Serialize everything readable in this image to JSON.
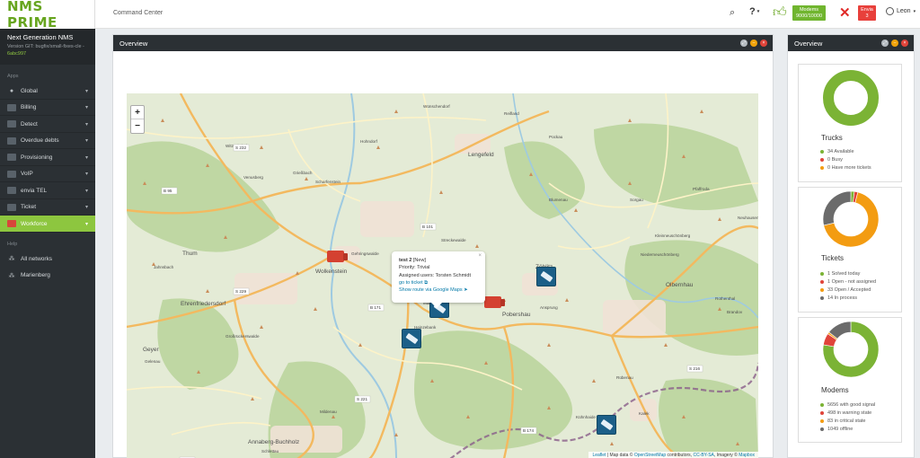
{
  "app": {
    "logo": "NMS PRIME",
    "version_title": "Next Generation NMS",
    "version_text": "Version GIT: bugfix/small-fixes-cle -",
    "version_hash": "6abc997"
  },
  "sidebar": {
    "apps_label": "Apps",
    "help_label": "Help",
    "items": [
      {
        "label": "Global",
        "icon": "globe-icon",
        "active": false
      },
      {
        "label": "Billing",
        "icon": "billing-icon",
        "active": false
      },
      {
        "label": "Detect",
        "icon": "detect-icon",
        "active": false
      },
      {
        "label": "Overdue debts",
        "icon": "overdue-icon",
        "active": false
      },
      {
        "label": "Provisioning",
        "icon": "provisioning-icon",
        "active": false
      },
      {
        "label": "VoIP",
        "icon": "voip-icon",
        "active": false
      },
      {
        "label": "envia TEL",
        "icon": "envia-icon",
        "active": false
      },
      {
        "label": "Ticket",
        "icon": "ticket-icon",
        "active": false
      },
      {
        "label": "Workforce",
        "icon": "workforce-icon",
        "active": true
      }
    ],
    "help_items": [
      {
        "label": "All networks",
        "icon": "network-icon"
      },
      {
        "label": "Marienberg",
        "icon": "network-icon"
      }
    ]
  },
  "header": {
    "title": "Command Center",
    "modems_badge_label": "Modems",
    "modems_badge_value": "9000/10000",
    "envia_badge_label": "Envia",
    "envia_badge_value": "3",
    "user": "Leon",
    "help": "?"
  },
  "map_panel": {
    "title": "Overview",
    "zoom_in": "+",
    "zoom_out": "−",
    "popup": {
      "title": "test 2",
      "state": "[New]",
      "priority": "Priority: Trivial",
      "assigned": "Assigned users: Torsten Schmidt",
      "link_ticket": "go to ticket",
      "link_route": "Show route via Google Maps"
    },
    "attribution": {
      "leaflet": "Leaflet",
      "text1": " | Map data © ",
      "osm": "OpenStreetMap",
      "text2": " contributors, ",
      "ccbysa": "CC-BY-SA",
      "text3": ", Imagery © ",
      "mapbox": "Mapbox"
    },
    "places": [
      {
        "name": "Lengefeld"
      },
      {
        "name": "Wolkenstein"
      },
      {
        "name": "Ehrenfriedersdorf"
      },
      {
        "name": "Thum"
      },
      {
        "name": "Geyer"
      },
      {
        "name": "Annaberg-Buchholz"
      },
      {
        "name": "Olbernhau"
      },
      {
        "name": "Zöblitz"
      },
      {
        "name": "Pobershau"
      },
      {
        "name": "Marienberg"
      },
      {
        "name": "Großrückerswalde"
      },
      {
        "name": "Wünschendorf"
      },
      {
        "name": "Reifland"
      },
      {
        "name": "Pockau"
      },
      {
        "name": "Heinzebank"
      },
      {
        "name": "Rübenau"
      },
      {
        "name": "Kalek"
      },
      {
        "name": "Schlettau"
      },
      {
        "name": "Mildenau"
      },
      {
        "name": "Jahnsbach"
      },
      {
        "name": "Streckewalde"
      },
      {
        "name": "Gelenau"
      },
      {
        "name": "Venusberg"
      },
      {
        "name": "Witzschdorf"
      },
      {
        "name": "Grießbach"
      },
      {
        "name": "Scharfenstein"
      },
      {
        "name": "Hohndorf"
      },
      {
        "name": "Gehringswalde"
      },
      {
        "name": "Kühnhaide"
      },
      {
        "name": "Niederneuschönberg"
      },
      {
        "name": "Blumenau"
      },
      {
        "name": "Sorgau"
      },
      {
        "name": "Pfaffroda"
      },
      {
        "name": "Neuhausen"
      },
      {
        "name": "Rothenthal"
      },
      {
        "name": "Brandov"
      },
      {
        "name": "Ansprung"
      },
      {
        "name": "Kleinneuschönberg"
      }
    ],
    "roads": [
      {
        "label": "B 95"
      },
      {
        "label": "B 101"
      },
      {
        "label": "B 171"
      },
      {
        "label": "S 229"
      },
      {
        "label": "S 232"
      },
      {
        "label": "S 221"
      },
      {
        "label": "S 216"
      },
      {
        "label": "B 174"
      },
      {
        "label": "S 267"
      }
    ]
  },
  "overview": {
    "title": "Overview",
    "trucks": {
      "title": "Trucks",
      "items": [
        {
          "label": "34 Available",
          "color": "#7bb335",
          "value": 34
        },
        {
          "label": "0 Busy",
          "color": "#e0443a",
          "value": 0
        },
        {
          "label": "0 Have more tickets",
          "color": "#f39c12",
          "value": 0
        }
      ]
    },
    "tickets": {
      "title": "Tickets",
      "items": [
        {
          "label": "1 Solved today",
          "color": "#7bb335",
          "value": 1
        },
        {
          "label": "1 Open - not assigned",
          "color": "#e0443a",
          "value": 1
        },
        {
          "label": "33 Open / Accepted",
          "color": "#f39c12",
          "value": 33
        },
        {
          "label": "14 In process",
          "color": "#6b6b6b",
          "value": 14
        }
      ]
    },
    "modems": {
      "title": "Modems",
      "items": [
        {
          "label": "5656 with good signal",
          "color": "#7bb335",
          "value": 5656
        },
        {
          "label": "498 in warning state",
          "color": "#e0443a",
          "value": 498
        },
        {
          "label": "83 in critical state",
          "color": "#f39c12",
          "value": 83
        },
        {
          "label": "1049 offline",
          "color": "#6b6b6b",
          "value": 1049
        }
      ]
    }
  }
}
